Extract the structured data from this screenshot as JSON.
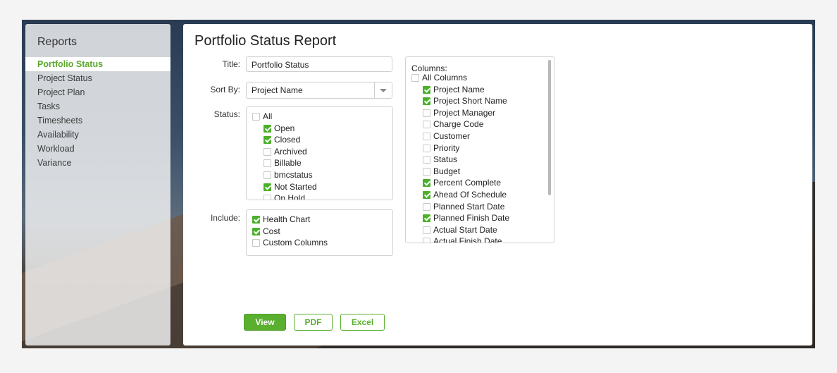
{
  "sidebar": {
    "title": "Reports",
    "items": [
      {
        "label": "Portfolio Status",
        "active": true
      },
      {
        "label": "Project Status"
      },
      {
        "label": "Project Plan"
      },
      {
        "label": "Tasks"
      },
      {
        "label": "Timesheets"
      },
      {
        "label": "Availability"
      },
      {
        "label": "Workload"
      },
      {
        "label": "Variance"
      }
    ]
  },
  "main": {
    "heading": "Portfolio Status Report",
    "title_label": "Title:",
    "title_value": "Portfolio Status",
    "sortby_label": "Sort By:",
    "sortby_value": "Project Name",
    "status_label": "Status:",
    "status_options": [
      {
        "label": "All",
        "checked": false
      },
      {
        "label": "Open",
        "checked": true
      },
      {
        "label": "Closed",
        "checked": true
      },
      {
        "label": "Archived",
        "checked": false
      },
      {
        "label": "Billable",
        "checked": false
      },
      {
        "label": "bmcstatus",
        "checked": false
      },
      {
        "label": "Not Started",
        "checked": true
      },
      {
        "label": "On Hold",
        "checked": false
      }
    ],
    "include_label": "Include:",
    "include_options": [
      {
        "label": "Health Chart",
        "checked": true
      },
      {
        "label": "Cost",
        "checked": true
      },
      {
        "label": "Custom Columns",
        "checked": false
      }
    ],
    "columns_label": "Columns:",
    "column_options": [
      {
        "label": "All Columns",
        "checked": false
      },
      {
        "label": "Project Name",
        "checked": true
      },
      {
        "label": "Project Short Name",
        "checked": true
      },
      {
        "label": "Project Manager",
        "checked": false
      },
      {
        "label": "Charge Code",
        "checked": false
      },
      {
        "label": "Customer",
        "checked": false
      },
      {
        "label": "Priority",
        "checked": false
      },
      {
        "label": "Status",
        "checked": false
      },
      {
        "label": "Budget",
        "checked": false
      },
      {
        "label": "Percent Complete",
        "checked": true
      },
      {
        "label": "Ahead Of Schedule",
        "checked": true
      },
      {
        "label": "Planned Start Date",
        "checked": false
      },
      {
        "label": "Planned Finish Date",
        "checked": true
      },
      {
        "label": "Actual Start Date",
        "checked": false
      },
      {
        "label": "Actual Finish Date",
        "checked": false
      }
    ],
    "buttons": {
      "view": "View",
      "pdf": "PDF",
      "excel": "Excel"
    }
  },
  "colors": {
    "accent": "#5aaf2f",
    "active_nav": "#5aa82c"
  }
}
